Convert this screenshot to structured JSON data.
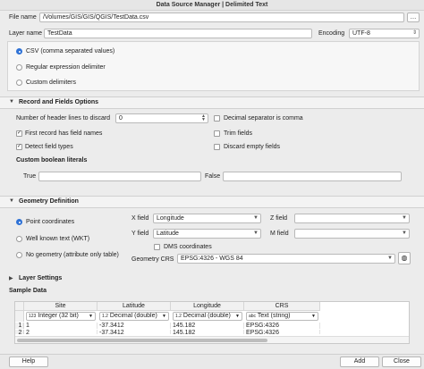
{
  "window": {
    "title": "Data Source Manager | Delimited Text"
  },
  "file": {
    "label": "File name",
    "value": "/Volumes/GIS/GIS/QGIS/TestData.csv",
    "browse": "…"
  },
  "layer": {
    "label": "Layer name",
    "value": "TestData",
    "encoding_label": "Encoding",
    "encoding_value": "UTF-8"
  },
  "format": {
    "options": [
      {
        "label": "CSV (comma separated values)",
        "selected": true
      },
      {
        "label": "Regular expression delimiter",
        "selected": false
      },
      {
        "label": "Custom delimiters",
        "selected": false
      }
    ]
  },
  "record": {
    "title": "Record and Fields Options",
    "header_lines_label": "Number of header lines to discard",
    "header_lines_value": "0",
    "decimal_comma": "Decimal separator is comma",
    "first_record": "First record has field names",
    "trim_fields": "Trim fields",
    "detect_types": "Detect field types",
    "discard_empty": "Discard empty fields",
    "custom_bool": "Custom boolean literals",
    "true_label": "True",
    "false_label": "False"
  },
  "geometry": {
    "title": "Geometry Definition",
    "point": "Point coordinates",
    "wkt": "Well known text (WKT)",
    "none": "No geometry (attribute only table)",
    "x_label": "X field",
    "x_value": "Longitude",
    "y_label": "Y field",
    "y_value": "Latitude",
    "z_label": "Z field",
    "m_label": "M field",
    "dms": "DMS coordinates",
    "crs_label": "Geometry CRS",
    "crs_value": "EPSG:4326 - WGS 84"
  },
  "layer_settings": {
    "title": "Layer Settings"
  },
  "sample": {
    "title": "Sample Data",
    "columns": [
      "Site",
      "Latitude",
      "Longitude",
      "CRS"
    ],
    "types": [
      {
        "badge": "123",
        "label": "Integer (32 bit)"
      },
      {
        "badge": "1.2",
        "label": "Decimal (double)"
      },
      {
        "badge": "1.2",
        "label": "Decimal (double)"
      },
      {
        "badge": "abc",
        "label": "Text (string)"
      }
    ],
    "rows": [
      {
        "num": "1",
        "cells": [
          "1",
          "-37.3412",
          "145.182",
          "EPSG:4326"
        ]
      },
      {
        "num": "2",
        "cells": [
          "2",
          "-37.3412",
          "145.182",
          "EPSG:4326"
        ]
      }
    ]
  },
  "buttons": {
    "help": "Help",
    "add": "Add",
    "close": "Close"
  }
}
